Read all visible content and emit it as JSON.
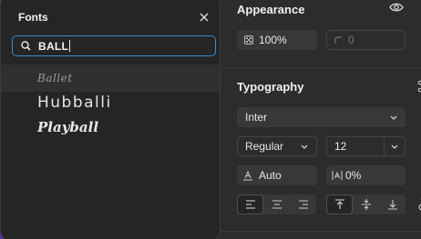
{
  "fonts_panel": {
    "title": "Fonts",
    "search": {
      "value": "BALL",
      "placeholder": ""
    },
    "items": [
      {
        "name": "Ballet"
      },
      {
        "name": "Hubballi"
      },
      {
        "name": "Playball"
      }
    ]
  },
  "properties": {
    "appearance": {
      "title": "Appearance",
      "opacity": "100%",
      "radius": "0"
    },
    "typography": {
      "title": "Typography",
      "font_family": "Inter",
      "font_weight": "Regular",
      "font_size": "12",
      "line_height": "Auto",
      "letter_spacing": "0%"
    }
  },
  "colors": {
    "accent": "#2f8fd8",
    "panel": "#2c2c2c",
    "popover": "#252525",
    "background": "#5a2fa0"
  }
}
